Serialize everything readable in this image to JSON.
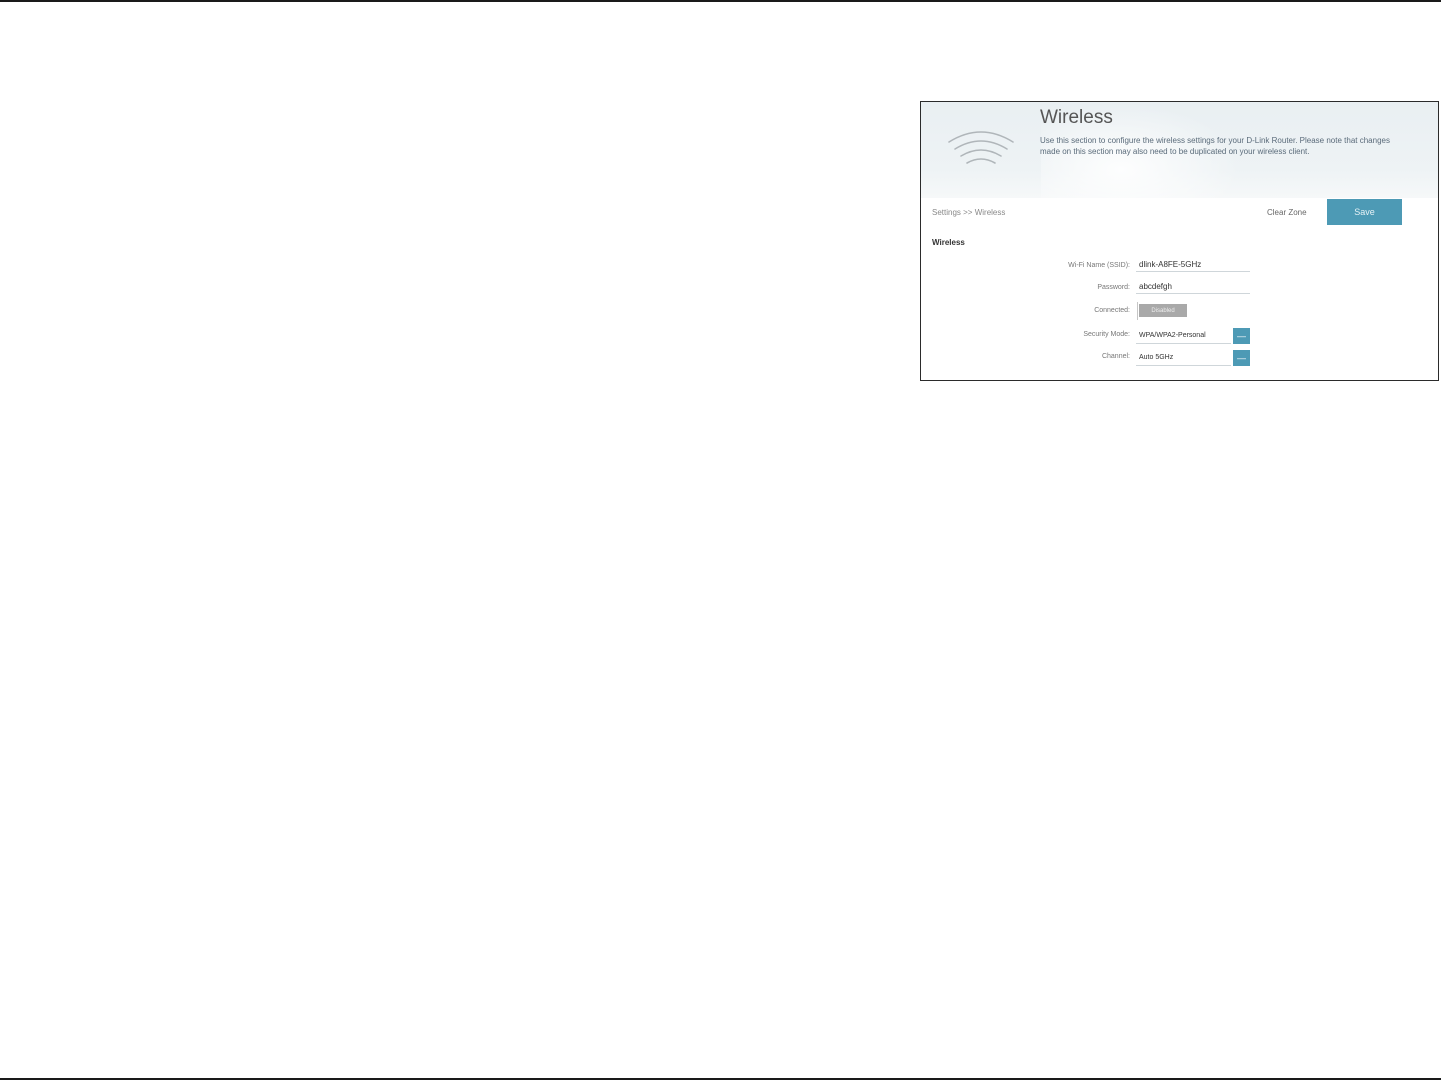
{
  "page": {
    "title": "Wireless",
    "description": "Use this section to configure the wireless settings for your D-Link Router. Please note that changes made on this section may also need to be duplicated on your wireless client.",
    "breadcrumb": "Settings >> Wireless",
    "clear_label": "Clear Zone",
    "save_label": "Save",
    "section_title": "Wireless"
  },
  "fields": {
    "network_name": {
      "label": "Wi-Fi Name (SSID):",
      "value": "dlink-A8FE-5GHz"
    },
    "password": {
      "label": "Password:",
      "value": "abcdefgh"
    },
    "connected": {
      "label": "Connected:",
      "state": "Disabled"
    },
    "security_mode": {
      "label": "Security Mode:",
      "value": "WPA/WPA2-Personal"
    },
    "channel": {
      "label": "Channel:",
      "value": "Auto 5GHz"
    }
  },
  "icons": {
    "wifi": "wifi-icon",
    "dropdown": "chevron-down-icon"
  },
  "colors": {
    "accent": "#4d9ab5",
    "toggle_off": "#a9a9a9",
    "rule": "#1a1a1a"
  }
}
